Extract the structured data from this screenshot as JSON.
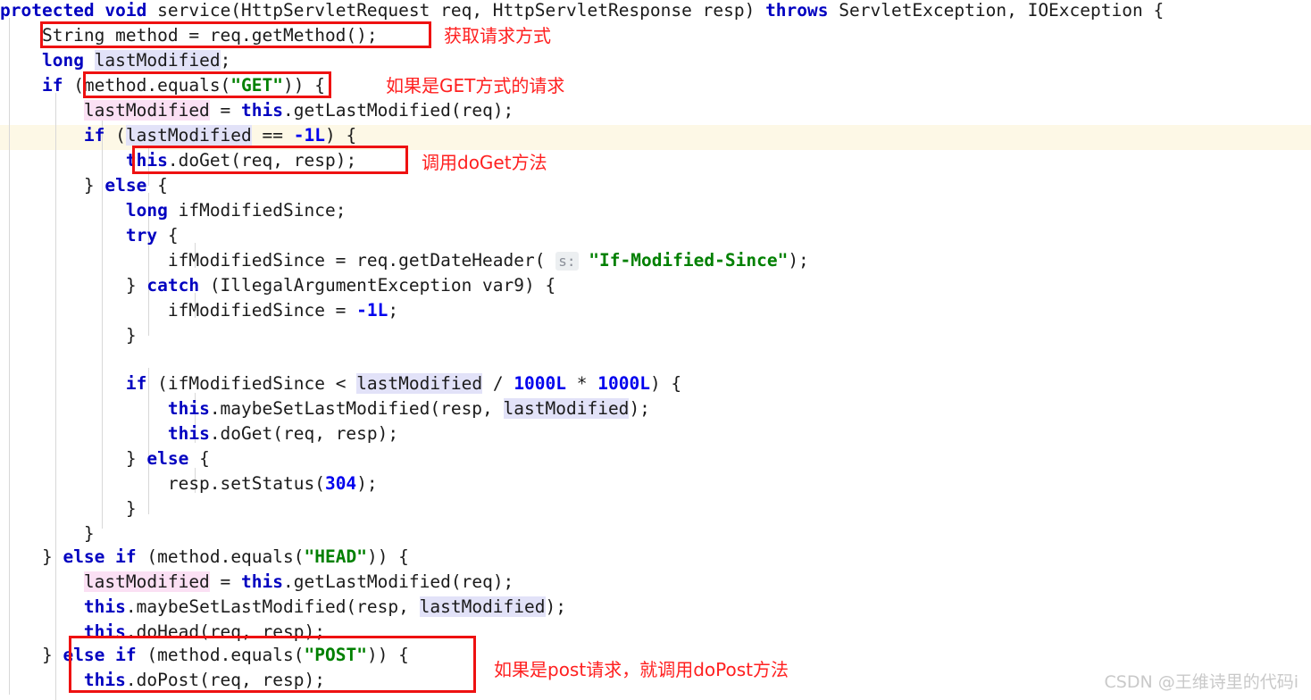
{
  "editor": {
    "language": "java",
    "font_size_px": 19.5,
    "line_height_px": 28,
    "background": "#ffffff",
    "caret_line_background": "#fdf8e6",
    "colors": {
      "keyword": "#0000c0",
      "string": "#008000",
      "number": "#0000ee",
      "plain": "#1b1b1b",
      "write_occurrence_highlight": "#fbe0f4",
      "read_occurrence_highlight": "#e2e2f8",
      "annotation_red": "#ff2020",
      "box_red": "#ee1111",
      "indent_guide": "#d8d8d8",
      "param_hint_bg": "#eceff1",
      "param_hint_fg": "#8a8f98"
    },
    "caret_line_index": 5,
    "lines": [
      {
        "index": 0,
        "text": "protected void service(HttpServletRequest req, HttpServletResponse resp) throws ServletException, IOException {"
      },
      {
        "index": 1,
        "text": "    String method = req.getMethod();"
      },
      {
        "index": 2,
        "text": "    long lastModified;"
      },
      {
        "index": 3,
        "text": "    if (method.equals(\"GET\")) {"
      },
      {
        "index": 4,
        "text": "        lastModified = this.getLastModified(req);"
      },
      {
        "index": 5,
        "text": "        if (lastModified == -1L) {"
      },
      {
        "index": 6,
        "text": "            this.doGet(req, resp);"
      },
      {
        "index": 7,
        "text": "        } else {"
      },
      {
        "index": 8,
        "text": "            long ifModifiedSince;"
      },
      {
        "index": 9,
        "text": "            try {"
      },
      {
        "index": 10,
        "text": "                ifModifiedSince = req.getDateHeader( s: \"If-Modified-Since\");"
      },
      {
        "index": 11,
        "text": "            } catch (IllegalArgumentException var9) {"
      },
      {
        "index": 12,
        "text": "                ifModifiedSince = -1L;"
      },
      {
        "index": 13,
        "text": "            }"
      },
      {
        "index": 14,
        "text": ""
      },
      {
        "index": 15,
        "text": "            if (ifModifiedSince < lastModified / 1000L * 1000L) {"
      },
      {
        "index": 16,
        "text": "                this.maybeSetLastModified(resp, lastModified);"
      },
      {
        "index": 17,
        "text": "                this.doGet(req, resp);"
      },
      {
        "index": 18,
        "text": "            } else {"
      },
      {
        "index": 19,
        "text": "                resp.setStatus(304);"
      },
      {
        "index": 20,
        "text": "            }"
      },
      {
        "index": 21,
        "text": "        }"
      },
      {
        "index": 22,
        "text": "    } else if (method.equals(\"HEAD\")) {"
      },
      {
        "index": 23,
        "text": "        lastModified = this.getLastModified(req);"
      },
      {
        "index": 24,
        "text": "        this.maybeSetLastModified(resp, lastModified);"
      },
      {
        "index": 25,
        "text": "        this.doHead(req, resp);"
      },
      {
        "index": 26,
        "text": "    } else if (method.equals(\"POST\")) {"
      },
      {
        "index": 27,
        "text": "        this.doPost(req, resp);"
      }
    ],
    "parameter_hint": "s:"
  },
  "annotations": {
    "notes": [
      {
        "id": "note-get-method",
        "text": "获取请求方式"
      },
      {
        "id": "note-if-get",
        "text": "如果是GET方式的请求"
      },
      {
        "id": "note-call-doget",
        "text": "调用doGet方法"
      },
      {
        "id": "note-if-post",
        "text": "如果是post请求，就调用doPost方法"
      }
    ],
    "boxes": [
      {
        "id": "box-get-method",
        "target": "String method = req.getMethod();"
      },
      {
        "id": "box-if-get",
        "target": "(method.equals(\"GET\"))"
      },
      {
        "id": "box-call-doget",
        "target": "this.doGet(req, resp);"
      },
      {
        "id": "box-post",
        "target": "else if (method.equals(\"POST\")) { this.doPost(req, resp);"
      }
    ]
  },
  "watermark": {
    "text": "CSDN @王维诗里的代码i"
  }
}
